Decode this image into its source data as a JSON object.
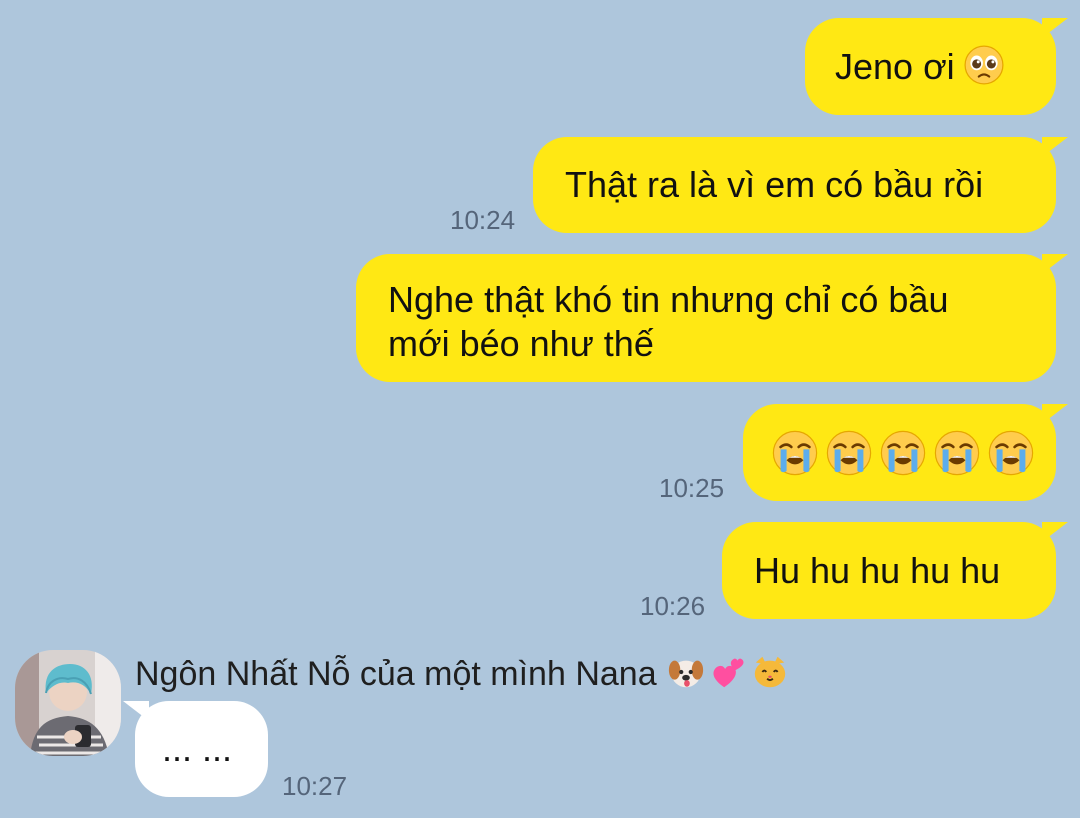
{
  "conversation": {
    "messages": [
      {
        "side": "sent",
        "text": "Jeno ơi",
        "emoji": "pleading-face-icon"
      },
      {
        "side": "sent",
        "text": "Thật ra là vì em có bầu rồi",
        "time": "10:24"
      },
      {
        "side": "sent",
        "lines": [
          "Nghe thật khó tin nhưng chỉ có bầu",
          "mới béo như thế"
        ]
      },
      {
        "side": "sent",
        "emoji_row": [
          "loudly-crying-face-icon",
          "loudly-crying-face-icon",
          "loudly-crying-face-icon",
          "loudly-crying-face-icon",
          "loudly-crying-face-icon"
        ],
        "time": "10:25"
      },
      {
        "side": "sent",
        "text": "Hu hu hu hu hu",
        "time": "10:26"
      },
      {
        "side": "received",
        "sender_name": "Ngôn Nhất Nỗ của một mình Nana",
        "sender_emojis": [
          "dog-face-icon",
          "two-hearts-icon",
          "cat-face-icon"
        ],
        "text": "... ...",
        "time": "10:27"
      }
    ]
  },
  "colors": {
    "background": "#aec6dc",
    "sent_bubble": "#ffe814",
    "received_bubble": "#ffffff",
    "timestamp": "#55657a"
  }
}
